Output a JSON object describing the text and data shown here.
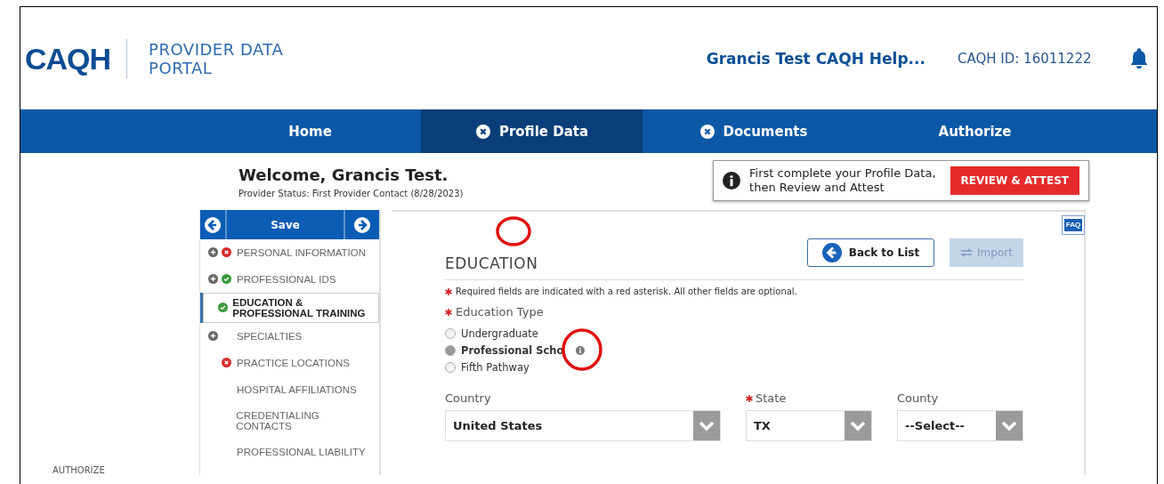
{
  "header": {
    "logo": "CAQH",
    "portal_title": [
      "PROVIDER DATA",
      "PORTAL"
    ],
    "user_name": "Grancis Test CAQH Help...",
    "caqh_id": "CAQH ID: 16011222"
  },
  "nav": [
    {
      "label": "Home",
      "selected": false,
      "incomplete": false
    },
    {
      "label": "Profile Data",
      "selected": true,
      "incomplete": true
    },
    {
      "label": "Documents",
      "selected": false,
      "incomplete": true
    },
    {
      "label": "Authorize",
      "selected": false,
      "incomplete": false
    }
  ],
  "welcome": {
    "title": "Welcome, Grancis Test.",
    "status": "Provider Status:  First Provider Contact (8/28/2023)"
  },
  "alert": {
    "message": [
      "First complete your Profile Data,",
      "then Review and Attest"
    ],
    "button": "REVIEW & ATTEST"
  },
  "sidebar": {
    "save": "Save",
    "items": [
      {
        "label": "PERSONAL INFORMATION",
        "expandable": true,
        "error": true,
        "complete": false,
        "selected": false
      },
      {
        "label": "PROFESSIONAL IDS",
        "expandable": true,
        "error": false,
        "complete": true,
        "selected": false
      },
      {
        "label": "EDUCATION & PROFESSIONAL TRAINING",
        "expandable": false,
        "error": false,
        "complete": true,
        "selected": true
      },
      {
        "label": "SPECIALTIES",
        "expandable": true,
        "error": false,
        "complete": false,
        "selected": false
      },
      {
        "label": "PRACTICE LOCATIONS",
        "expandable": false,
        "error": true,
        "complete": false,
        "selected": false
      },
      {
        "label": "HOSPITAL AFFILIATIONS",
        "expandable": false,
        "error": false,
        "complete": false,
        "selected": false
      },
      {
        "label": "CREDENTIALING CONTACTS",
        "expandable": false,
        "error": false,
        "complete": false,
        "selected": false
      },
      {
        "label": "PROFESSIONAL LIABILITY",
        "expandable": false,
        "error": false,
        "complete": false,
        "selected": false
      }
    ],
    "footer_link": "AUTHORIZE"
  },
  "form": {
    "title": "EDUCATION",
    "back_button": "Back to List",
    "import_button": "Import",
    "import_disabled": true,
    "required_note": "Required fields are indicated with a red asterisk. All other fields are optional.",
    "education_type": {
      "label": "Education Type",
      "required": true,
      "options": [
        {
          "label": "Undergraduate",
          "selected": false,
          "info": false
        },
        {
          "label": "Professional Scho",
          "selected": true,
          "info": true
        },
        {
          "label": "Fifth Pathway",
          "selected": false,
          "info": false
        }
      ]
    },
    "fields": [
      {
        "label": "Country",
        "required": false,
        "value": "United States"
      },
      {
        "label": "State",
        "required": true,
        "value": "TX"
      },
      {
        "label": "County",
        "required": false,
        "value": "--Select--"
      }
    ],
    "faq": "FAQ"
  }
}
